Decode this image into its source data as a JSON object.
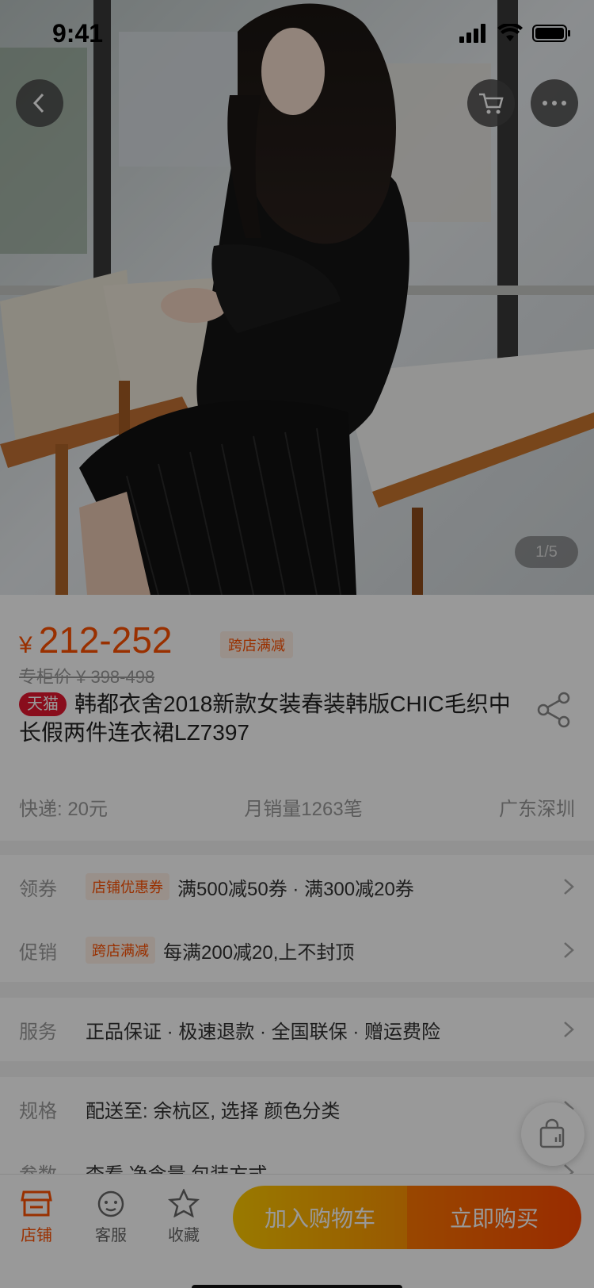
{
  "status_bar": {
    "time": "9:41"
  },
  "gallery": {
    "counter": "1/5"
  },
  "price": {
    "currency": "¥",
    "range": "212-252",
    "promo_tag": "跨店满减",
    "original": "专柜价 ¥ 398-498"
  },
  "product": {
    "badge": "天猫",
    "title": "韩都衣舍2018新款女装春装韩版CHIC毛织中长假两件连衣裙LZ7397"
  },
  "meta": {
    "shipping": "快递: 20元",
    "monthly_sales": "月销量1263笔",
    "location": "广东深圳"
  },
  "rows": {
    "coupon": {
      "label": "领券",
      "chip": "店铺优惠券",
      "text": "满500减50券 · 满300减20券"
    },
    "promotion": {
      "label": "促销",
      "chip": "跨店满减",
      "text": "每满200减20,上不封顶"
    },
    "service": {
      "label": "服务",
      "text": "正品保证 · 极速退款 · 全国联保 · 赠运费险"
    },
    "spec": {
      "label": "规格",
      "text": "配送至: 余杭区, 选择 颜色分类"
    },
    "params": {
      "label": "参数",
      "text": "查看 净含量 包装方式"
    }
  },
  "tabbar": {
    "shop": "店铺",
    "service": "客服",
    "favorite": "收藏",
    "add_to_cart": "加入购物车",
    "buy_now": "立即购买"
  },
  "colors": {
    "accent": "#ff5000",
    "tmall_red": "#e4162f",
    "cart_gradient": [
      "#ffcb00",
      "#ff9402"
    ],
    "buy_gradient": [
      "#ff7700",
      "#ff4900"
    ]
  },
  "icons": [
    "back-icon",
    "cart-icon",
    "more-icon",
    "share-icon",
    "shop-icon",
    "service-icon",
    "star-icon",
    "shopping-bag-icon",
    "chevron-right-icon"
  ]
}
